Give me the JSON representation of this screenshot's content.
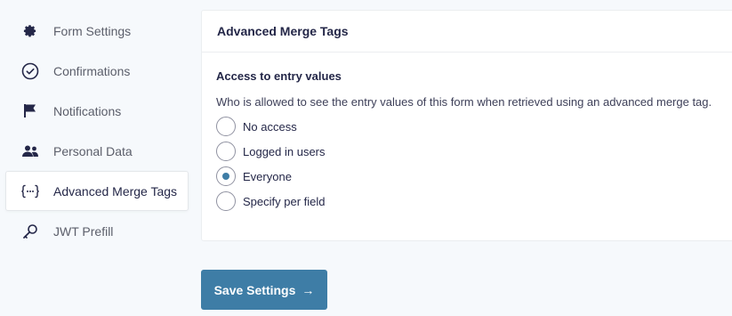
{
  "sidebar": {
    "items": [
      {
        "label": "Form Settings",
        "icon": "gear-icon",
        "active": false
      },
      {
        "label": "Confirmations",
        "icon": "check-circle-icon",
        "active": false
      },
      {
        "label": "Notifications",
        "icon": "flag-icon",
        "active": false
      },
      {
        "label": "Personal Data",
        "icon": "users-icon",
        "active": false
      },
      {
        "label": "Advanced Merge Tags",
        "icon": "merge-tag-braces-icon",
        "active": true
      },
      {
        "label": "JWT Prefill",
        "icon": "key-icon",
        "active": false
      }
    ]
  },
  "panel": {
    "title": "Advanced Merge Tags",
    "section_label": "Access to entry values",
    "description": "Who is allowed to see the entry values of this form when retrieved using an advanced merge tag.",
    "options": [
      {
        "label": "No access",
        "selected": false
      },
      {
        "label": "Logged in users",
        "selected": false
      },
      {
        "label": "Everyone",
        "selected": true
      },
      {
        "label": "Specify per field",
        "selected": false
      }
    ]
  },
  "save_button": {
    "label": "Save Settings",
    "arrow": "→"
  },
  "colors": {
    "accent": "#3e7da6",
    "background": "#f6f9fc",
    "text": "#242748"
  }
}
